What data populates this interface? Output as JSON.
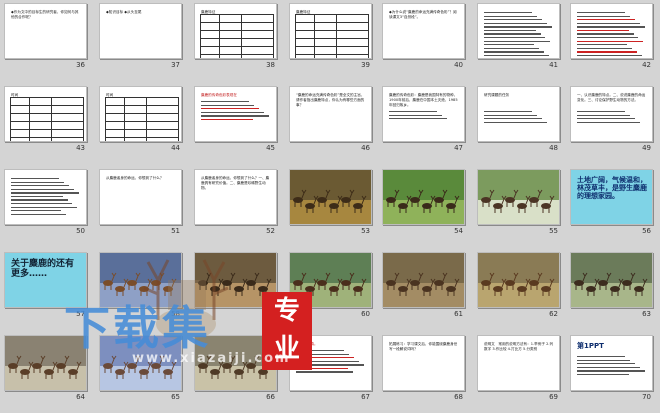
{
  "slides": [
    {
      "num": "36",
      "kind": "text",
      "title": "◆作为文中的目标生的研究者，你如何与其他的合作呢？",
      "lines": 0
    },
    {
      "num": "37",
      "kind": "text",
      "title": "◆知识目标\n◆从头至尾",
      "lines": 0
    },
    {
      "num": "38",
      "kind": "table",
      "header": "麋鹿特征",
      "lines": 0
    },
    {
      "num": "39",
      "kind": "table",
      "header": "麋鹿特征",
      "lines": 0
    },
    {
      "num": "40",
      "kind": "text",
      "title": "◆为什么说“麋鹿的命运充满传奇色彩”？阅读课文3“自然段”。",
      "lines": 0
    },
    {
      "num": "41",
      "kind": "dense",
      "title": "",
      "lines": 14
    },
    {
      "num": "42",
      "kind": "densered",
      "title": "",
      "lines": 14
    },
    {
      "num": "43",
      "kind": "table",
      "header": "时间",
      "lines": 0
    },
    {
      "num": "44",
      "kind": "table",
      "header": "时间",
      "lines": 0
    },
    {
      "num": "45",
      "kind": "redtitle",
      "title": "麋鹿的传奇色彩表现在",
      "lines": 6
    },
    {
      "num": "46",
      "kind": "text",
      "title": "“麋鹿的命运充满传奇色彩”是全文的主旨，请作者指出麋鹿特点，你认为有哪些方面的事？",
      "lines": 0
    },
    {
      "num": "47",
      "kind": "text",
      "title": "麋鹿的传奇色彩：麋鹿是我国特有的物种，1900年前后，麋鹿在中国本土灭绝，1985年回归故乡。",
      "lines": 3
    },
    {
      "num": "48",
      "kind": "text",
      "title": "研究课题的任务",
      "lines": 4
    },
    {
      "num": "49",
      "kind": "text",
      "title": "一、认识麋鹿的特点。二、说说麋鹿的命运变化。三、讨论保护野生动物的方法。",
      "lines": 4
    },
    {
      "num": "50",
      "kind": "dense",
      "title": "",
      "lines": 11
    },
    {
      "num": "51",
      "kind": "text",
      "title": "从麋鹿者身的命运，你想到了什么？",
      "lines": 0
    },
    {
      "num": "52",
      "kind": "text",
      "title": "从麋鹿者身的命运，你想到了什么？一、麋鹿具有研究价值。二、麋鹿是珍稀野生动物。",
      "lines": 0
    },
    {
      "num": "53",
      "kind": "photo",
      "scene": "herd-dry-grass",
      "lines": 0
    },
    {
      "num": "54",
      "kind": "photo",
      "scene": "stag-green-field",
      "lines": 0
    },
    {
      "num": "55",
      "kind": "photo",
      "scene": "herd-in-water",
      "lines": 0
    },
    {
      "num": "56",
      "kind": "blue",
      "title": "土地广阔，气候温和，林茂草丰，是野生麋鹿的理想家园。",
      "lines": 0
    },
    {
      "num": "57",
      "kind": "blue2",
      "title": "关于麋鹿的还有更多……",
      "lines": 0
    },
    {
      "num": "58",
      "kind": "photo",
      "scene": "antlers-closeup",
      "lines": 0
    },
    {
      "num": "59",
      "kind": "photo",
      "scene": "herd-brown-field",
      "lines": 0
    },
    {
      "num": "60",
      "kind": "photo",
      "scene": "running-in-water",
      "lines": 0
    },
    {
      "num": "61",
      "kind": "photo",
      "scene": "herd-mud",
      "lines": 0
    },
    {
      "num": "62",
      "kind": "photo",
      "scene": "herd-meadow",
      "lines": 0
    },
    {
      "num": "63",
      "kind": "photo",
      "scene": "herd-shade",
      "lines": 0
    },
    {
      "num": "64",
      "kind": "photo",
      "scene": "stags-fence",
      "lines": 0
    },
    {
      "num": "65",
      "kind": "photo",
      "scene": "pond-blue",
      "lines": 0
    },
    {
      "num": "66",
      "kind": "photo",
      "scene": "stags-bare-trees",
      "lines": 0
    },
    {
      "num": "67",
      "kind": "redtitle",
      "title": "一、填一填。",
      "lines": 7
    },
    {
      "num": "68",
      "kind": "text",
      "title": "拓展练习：学习课文后，你能围绕麋鹿身世写一段解说词吗？",
      "lines": 0
    },
    {
      "num": "69",
      "kind": "text",
      "title": "说明文　常用的说明方法有：1.举例子 2.列数字 3.作比较 4.打比方 5.分类别",
      "lines": 0
    },
    {
      "num": "70",
      "kind": "brand",
      "title": "第1PPT",
      "lines": 6
    }
  ],
  "watermark": {
    "main": "下载集",
    "badge": "专业",
    "url": "www.xiazaiji.com"
  }
}
